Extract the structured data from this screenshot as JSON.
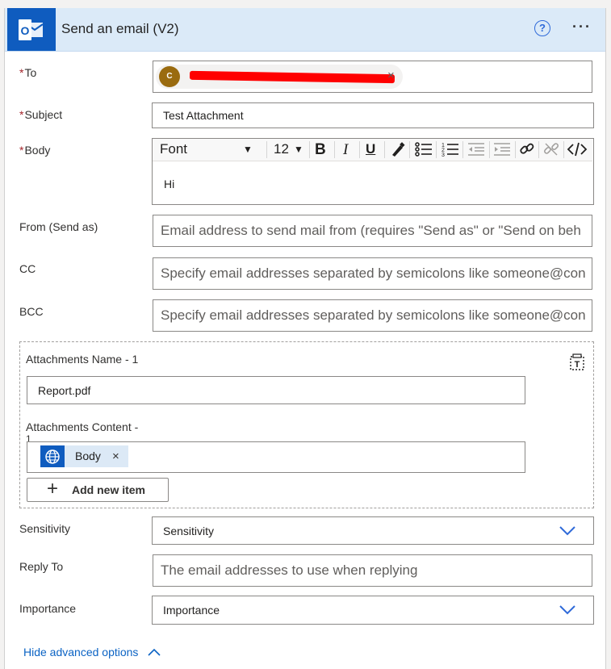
{
  "header": {
    "title": "Send an email (V2)",
    "help": "?",
    "more": "···"
  },
  "colors": {
    "header_bg": "#dbeaf8",
    "brand": "#0f5cbf",
    "required": "#a4262c",
    "link": "#0b63c4",
    "redaction": "#ff0000"
  },
  "fields": {
    "to": {
      "label": "To",
      "required": "*",
      "token_initial": "C",
      "token_text": "",
      "token_remove": "×"
    },
    "subject": {
      "label": "Subject",
      "required": "*",
      "value": "Test Attachment"
    },
    "body": {
      "label": "Body",
      "required": "*",
      "value": "Hi",
      "toolbar": {
        "font": "Font",
        "size": "12",
        "bold": "B",
        "italic": "I",
        "underline": "U"
      }
    },
    "from": {
      "label": "From (Send as)",
      "placeholder": "Email address to send mail from (requires \"Send as\" or \"Send on beh"
    },
    "cc": {
      "label": "CC",
      "placeholder": "Specify email addresses separated by semicolons like someone@con"
    },
    "bcc": {
      "label": "BCC",
      "placeholder": "Specify email addresses separated by semicolons like someone@con"
    }
  },
  "attachments": {
    "name_label": "Attachments Name - 1",
    "name_value": "Report.pdf",
    "content_label": "Attachments Content -",
    "content_label_cont": "1",
    "content_token": "Body",
    "content_token_remove": "×",
    "add_button": "Add new item"
  },
  "sensitivity": {
    "label": "Sensitivity",
    "value": "Sensitivity"
  },
  "reply_to": {
    "label": "Reply To",
    "placeholder": "The email addresses to use when replying"
  },
  "importance": {
    "label": "Importance",
    "value": "Importance"
  },
  "advanced_link": "Hide advanced options"
}
